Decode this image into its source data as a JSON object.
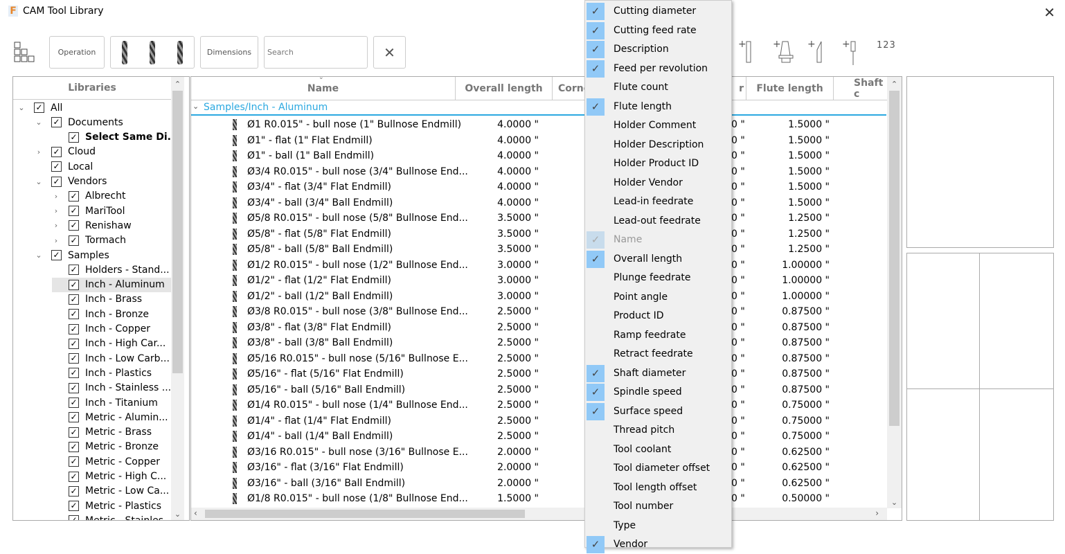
{
  "window": {
    "title": "CAM Tool Library",
    "logo": "F",
    "close_icon": "close-icon"
  },
  "toolbar": {
    "operation": "Operation",
    "dimensions": "Dimensions",
    "search_placeholder": "Search",
    "clear": "✕",
    "numbering": "123"
  },
  "libraries": {
    "header": "Libraries",
    "items": [
      {
        "label": "All",
        "level": 0,
        "chevron": "down",
        "bold": false
      },
      {
        "label": "Documents",
        "level": 1,
        "chevron": "down"
      },
      {
        "label": "Select Same Di...",
        "level": 2,
        "chevron": "",
        "bold": true
      },
      {
        "label": "Cloud",
        "level": 1,
        "chevron": "right"
      },
      {
        "label": "Local",
        "level": 1,
        "chevron": ""
      },
      {
        "label": "Vendors",
        "level": 1,
        "chevron": "down"
      },
      {
        "label": "Albrecht",
        "level": 2,
        "chevron": "right"
      },
      {
        "label": "MariTool",
        "level": 2,
        "chevron": "right"
      },
      {
        "label": "Renishaw",
        "level": 2,
        "chevron": "right"
      },
      {
        "label": "Tormach",
        "level": 2,
        "chevron": "right"
      },
      {
        "label": "Samples",
        "level": 1,
        "chevron": "down"
      },
      {
        "label": "Holders - Stand...",
        "level": 2,
        "chevron": ""
      },
      {
        "label": "Inch - Aluminum",
        "level": 2,
        "chevron": "",
        "selected": true
      },
      {
        "label": "Inch - Brass",
        "level": 2,
        "chevron": ""
      },
      {
        "label": "Inch - Bronze",
        "level": 2,
        "chevron": ""
      },
      {
        "label": "Inch - Copper",
        "level": 2,
        "chevron": ""
      },
      {
        "label": "Inch - High Car...",
        "level": 2,
        "chevron": ""
      },
      {
        "label": "Inch - Low Carb...",
        "level": 2,
        "chevron": ""
      },
      {
        "label": "Inch - Plastics",
        "level": 2,
        "chevron": ""
      },
      {
        "label": "Inch - Stainless ...",
        "level": 2,
        "chevron": ""
      },
      {
        "label": "Inch - Titanium",
        "level": 2,
        "chevron": ""
      },
      {
        "label": "Metric - Alumin...",
        "level": 2,
        "chevron": ""
      },
      {
        "label": "Metric - Brass",
        "level": 2,
        "chevron": ""
      },
      {
        "label": "Metric - Bronze",
        "level": 2,
        "chevron": ""
      },
      {
        "label": "Metric - Copper",
        "level": 2,
        "chevron": ""
      },
      {
        "label": "Metric - High C...",
        "level": 2,
        "chevron": ""
      },
      {
        "label": "Metric - Low Ca...",
        "level": 2,
        "chevron": ""
      },
      {
        "label": "Metric - Plastics",
        "level": 2,
        "chevron": ""
      },
      {
        "label": "Metric - Stainles...",
        "level": 2,
        "chevron": ""
      }
    ]
  },
  "table": {
    "columns": [
      "Name",
      "Overall length",
      "Corne",
      "r",
      "Flute length",
      "Shaft c"
    ],
    "group": "Samples/Inch - Aluminum",
    "rows": [
      [
        "Ø1 R0.015\" - bull nose (1\" Bullnose Endmill)",
        "4.0000 \"",
        "0 \"",
        "1.5000 \""
      ],
      [
        "Ø1\" - flat (1\" Flat Endmill)",
        "4.0000 \"",
        "0 \"",
        "1.5000 \""
      ],
      [
        "Ø1\" - ball (1\" Ball Endmill)",
        "4.0000 \"",
        "0 \"",
        "1.5000 \""
      ],
      [
        "Ø3/4 R0.015\" - bull nose (3/4\" Bullnose End...",
        "4.0000 \"",
        "0 \"",
        "1.5000 \""
      ],
      [
        "Ø3/4\" - flat (3/4\" Flat Endmill)",
        "4.0000 \"",
        "0 \"",
        "1.5000 \""
      ],
      [
        "Ø3/4\" - ball (3/4\" Ball Endmill)",
        "4.0000 \"",
        "0 \"",
        "1.5000 \""
      ],
      [
        "Ø5/8 R0.015\" - bull nose (5/8\" Bullnose End...",
        "3.5000 \"",
        "0 \"",
        "1.2500 \""
      ],
      [
        "Ø5/8\" - flat (5/8\" Flat Endmill)",
        "3.5000 \"",
        "0 \"",
        "1.2500 \""
      ],
      [
        "Ø5/8\" - ball (5/8\" Ball Endmill)",
        "3.5000 \"",
        "0 \"",
        "1.2500 \""
      ],
      [
        "Ø1/2 R0.015\" - bull nose (1/2\" Bullnose End...",
        "3.0000 \"",
        "0 \"",
        "1.00000 \""
      ],
      [
        "Ø1/2\" - flat (1/2\" Flat Endmill)",
        "3.0000 \"",
        "0 \"",
        "1.00000 \""
      ],
      [
        "Ø1/2\" - ball (1/2\" Ball Endmill)",
        "3.0000 \"",
        "0 \"",
        "1.00000 \""
      ],
      [
        "Ø3/8 R0.015\" - bull nose (3/8\" Bullnose End...",
        "2.5000 \"",
        "0 \"",
        "0.87500 \""
      ],
      [
        "Ø3/8\" - flat (3/8\" Flat Endmill)",
        "2.5000 \"",
        "0 \"",
        "0.87500 \""
      ],
      [
        "Ø3/8\" - ball (3/8\" Ball Endmill)",
        "2.5000 \"",
        "0 \"",
        "0.87500 \""
      ],
      [
        "Ø5/16 R0.015\" - bull nose (5/16\" Bullnose E...",
        "2.5000 \"",
        "0 \"",
        "0.87500 \""
      ],
      [
        "Ø5/16\" - flat (5/16\" Flat Endmill)",
        "2.5000 \"",
        "0 \"",
        "0.87500 \""
      ],
      [
        "Ø5/16\" - ball (5/16\" Ball Endmill)",
        "2.5000 \"",
        "0 \"",
        "0.87500 \""
      ],
      [
        "Ø1/4 R0.015\" - bull nose (1/4\" Bullnose End...",
        "2.5000 \"",
        "0 \"",
        "0.75000 \""
      ],
      [
        "Ø1/4\" - flat (1/4\" Flat Endmill)",
        "2.5000 \"",
        "0 \"",
        "0.75000 \""
      ],
      [
        "Ø1/4\" - ball (1/4\" Ball Endmill)",
        "2.5000 \"",
        "0 \"",
        "0.75000 \""
      ],
      [
        "Ø3/16 R0.015\" - bull nose (3/16\" Bullnose E...",
        "2.0000 \"",
        "0 \"",
        "0.62500 \""
      ],
      [
        "Ø3/16\" - flat (3/16\" Flat Endmill)",
        "2.0000 \"",
        "0 \"",
        "0.62500 \""
      ],
      [
        "Ø3/16\" - ball (3/16\" Ball Endmill)",
        "2.0000 \"",
        "0 \"",
        "0.62500 \""
      ],
      [
        "Ø1/8 R0.015\" - bull nose (1/8\" Bullnose End...",
        "1.5000 \"",
        "0 \"",
        "0.50000 \""
      ]
    ]
  },
  "column_menu": {
    "check_color": "#91c9f7",
    "items": [
      {
        "label": "Cutting diameter",
        "checked": true
      },
      {
        "label": "Cutting feed rate",
        "checked": true
      },
      {
        "label": "Description",
        "checked": true
      },
      {
        "label": "Feed per revolution",
        "checked": true
      },
      {
        "label": "Flute count",
        "checked": false
      },
      {
        "label": "Flute length",
        "checked": true
      },
      {
        "label": "Holder Comment",
        "checked": false
      },
      {
        "label": "Holder Description",
        "checked": false
      },
      {
        "label": "Holder Product ID",
        "checked": false
      },
      {
        "label": "Holder Vendor",
        "checked": false
      },
      {
        "label": "Lead-in feedrate",
        "checked": false
      },
      {
        "label": "Lead-out feedrate",
        "checked": false
      },
      {
        "label": "Name",
        "checked": true,
        "disabled": true
      },
      {
        "label": "Overall length",
        "checked": true
      },
      {
        "label": "Plunge feedrate",
        "checked": false
      },
      {
        "label": "Point angle",
        "checked": false
      },
      {
        "label": "Product ID",
        "checked": false
      },
      {
        "label": "Ramp feedrate",
        "checked": false
      },
      {
        "label": "Retract feedrate",
        "checked": false
      },
      {
        "label": "Shaft diameter",
        "checked": true
      },
      {
        "label": "Spindle speed",
        "checked": true
      },
      {
        "label": "Surface speed",
        "checked": true
      },
      {
        "label": "Thread pitch",
        "checked": false
      },
      {
        "label": "Tool coolant",
        "checked": false
      },
      {
        "label": "Tool diameter offset",
        "checked": false
      },
      {
        "label": "Tool length offset",
        "checked": false
      },
      {
        "label": "Tool number",
        "checked": false
      },
      {
        "label": "Type",
        "checked": false
      },
      {
        "label": "Vendor",
        "checked": true
      }
    ]
  }
}
